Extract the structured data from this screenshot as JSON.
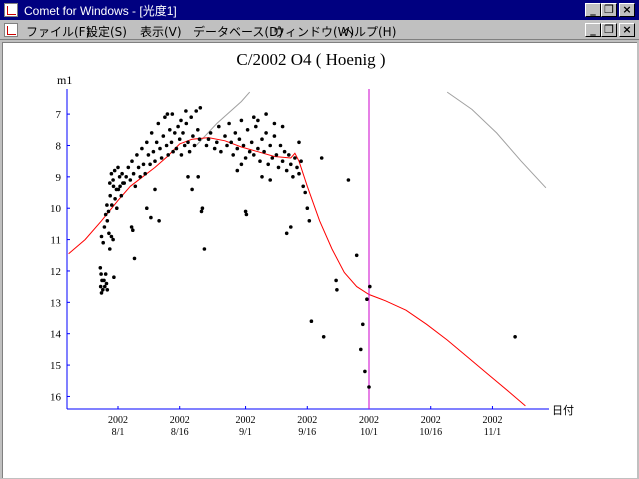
{
  "window": {
    "title": "Comet for Windows - [光度1]",
    "buttons": {
      "minimize": "_",
      "restore": "❐",
      "close": "×"
    }
  },
  "menu": {
    "items": [
      "ファイル(F)",
      "設定(S)",
      "表示(V)",
      "データベース(D)",
      "ウィンドウ(W)",
      "ヘルプ(H)"
    ]
  },
  "chart_data": {
    "type": "scatter",
    "title": "C/2002 O4 ( Hoenig )",
    "ylabel": "m1",
    "xlabel": "日付",
    "y_ticks": [
      7,
      8,
      9,
      10,
      11,
      12,
      13,
      14,
      15,
      16
    ],
    "ylim": [
      6.2,
      16.4
    ],
    "xlim_day": [
      -15.5,
      70.5
    ],
    "x_ticks": [
      {
        "day": 0,
        "label": "2002\n8/1"
      },
      {
        "day": 15,
        "label": "2002\n8/16"
      },
      {
        "day": 31,
        "label": "2002\n9/1"
      },
      {
        "day": 46,
        "label": "2002\n9/16"
      },
      {
        "day": 61,
        "label": "2002\n10/1"
      },
      {
        "day": 76,
        "label": "2002\n10/16"
      },
      {
        "day": 91,
        "label": "2002\n11/1"
      }
    ],
    "current_date_day": 61,
    "colors": {
      "observations": "#000000",
      "model_curve": "#ff0000",
      "current_date": "#cc00cc",
      "axes": "#0000ff",
      "secondary_curve": "#a0a0a0"
    },
    "model_curve": [
      [
        -12,
        11.45
      ],
      [
        -8,
        11.0
      ],
      [
        -4,
        10.4
      ],
      [
        0,
        9.75
      ],
      [
        3,
        9.3
      ],
      [
        6,
        9.0
      ],
      [
        9,
        8.7
      ],
      [
        12,
        8.35
      ],
      [
        15,
        7.95
      ],
      [
        18,
        7.8
      ],
      [
        22,
        7.75
      ],
      [
        26,
        7.85
      ],
      [
        30,
        8.05
      ],
      [
        34,
        8.2
      ],
      [
        38,
        8.35
      ],
      [
        42,
        8.4
      ],
      [
        43,
        8.25
      ],
      [
        44,
        8.5
      ],
      [
        46,
        9.3
      ],
      [
        49,
        10.4
      ],
      [
        52,
        11.3
      ],
      [
        55,
        12.05
      ],
      [
        58,
        12.5
      ],
      [
        61,
        12.75
      ],
      [
        65,
        12.95
      ],
      [
        70,
        13.25
      ],
      [
        75,
        13.7
      ],
      [
        80,
        14.2
      ],
      [
        85,
        14.75
      ],
      [
        90,
        15.3
      ],
      [
        95,
        15.85
      ],
      [
        99,
        16.3
      ]
    ],
    "secondary_curve": [
      [
        19,
        8.0
      ],
      [
        24,
        7.3
      ],
      [
        30,
        6.6
      ],
      [
        32,
        6.3
      ]
    ],
    "secondary_curve_2": [
      [
        80,
        6.3
      ],
      [
        86,
        6.85
      ],
      [
        92,
        7.6
      ],
      [
        98,
        8.5
      ],
      [
        104,
        9.35
      ]
    ],
    "observations": [
      [
        -4.3,
        11.9
      ],
      [
        -4.1,
        12.1
      ],
      [
        -3.9,
        12.3
      ],
      [
        -4.2,
        12.5
      ],
      [
        -4.0,
        12.7
      ],
      [
        -3.7,
        12.6
      ],
      [
        -3.4,
        12.3
      ],
      [
        -3.2,
        12.5
      ],
      [
        -3.0,
        12.1
      ],
      [
        -2.8,
        12.4
      ],
      [
        -2.6,
        12.6
      ],
      [
        -4.0,
        10.9
      ],
      [
        -3.6,
        11.1
      ],
      [
        -3.3,
        10.6
      ],
      [
        -3.0,
        10.2
      ],
      [
        -2.6,
        10.4
      ],
      [
        -2.2,
        10.8
      ],
      [
        -2.0,
        11.3
      ],
      [
        -1.6,
        10.9
      ],
      [
        -1.2,
        11.0
      ],
      [
        -1.0,
        12.2
      ],
      [
        -2.7,
        9.9
      ],
      [
        -2.3,
        10.1
      ],
      [
        -1.9,
        9.6
      ],
      [
        -1.5,
        9.9
      ],
      [
        -1.1,
        9.3
      ],
      [
        -0.7,
        9.7
      ],
      [
        -0.3,
        10.0
      ],
      [
        0.1,
        9.4
      ],
      [
        0.4,
        9.0
      ],
      [
        0.8,
        9.6
      ],
      [
        1.2,
        9.2
      ],
      [
        -2.0,
        9.2
      ],
      [
        -1.6,
        8.9
      ],
      [
        -1.2,
        9.1
      ],
      [
        -0.8,
        8.8
      ],
      [
        -0.4,
        9.4
      ],
      [
        0.0,
        8.7
      ],
      [
        0.5,
        9.3
      ],
      [
        1.0,
        8.9
      ],
      [
        1.5,
        9.2
      ],
      [
        2.0,
        9.0
      ],
      [
        2.5,
        8.7
      ],
      [
        3.0,
        9.1
      ],
      [
        3.4,
        8.5
      ],
      [
        3.8,
        8.9
      ],
      [
        4.2,
        9.3
      ],
      [
        4.6,
        8.3
      ],
      [
        5.0,
        8.7
      ],
      [
        5.4,
        9.0
      ],
      [
        5.8,
        8.1
      ],
      [
        6.2,
        8.6
      ],
      [
        6.6,
        8.9
      ],
      [
        7.0,
        7.9
      ],
      [
        3.3,
        10.6
      ],
      [
        3.6,
        10.7
      ],
      [
        4.0,
        11.6
      ],
      [
        7.0,
        10.0
      ],
      [
        8.0,
        10.3
      ],
      [
        9.0,
        9.4
      ],
      [
        10.0,
        10.4
      ],
      [
        7.4,
        8.3
      ],
      [
        7.8,
        8.6
      ],
      [
        8.2,
        7.6
      ],
      [
        8.6,
        8.2
      ],
      [
        9.0,
        8.5
      ],
      [
        9.4,
        7.9
      ],
      [
        9.8,
        7.3
      ],
      [
        10.2,
        8.1
      ],
      [
        10.6,
        8.4
      ],
      [
        11.0,
        7.7
      ],
      [
        11.4,
        7.1
      ],
      [
        11.8,
        8.0
      ],
      [
        12.2,
        8.3
      ],
      [
        12.6,
        7.5
      ],
      [
        13.0,
        7.9
      ],
      [
        13.4,
        8.2
      ],
      [
        13.8,
        7.6
      ],
      [
        14.2,
        8.1
      ],
      [
        14.6,
        7.4
      ],
      [
        15.0,
        7.8
      ],
      [
        15.4,
        8.3
      ],
      [
        15.8,
        7.6
      ],
      [
        16.2,
        8.0
      ],
      [
        16.6,
        7.3
      ],
      [
        17.0,
        7.9
      ],
      [
        17.4,
        8.2
      ],
      [
        17.8,
        7.1
      ],
      [
        18.2,
        7.7
      ],
      [
        18.6,
        8.0
      ],
      [
        19.0,
        6.9
      ],
      [
        19.4,
        7.5
      ],
      [
        19.8,
        7.8
      ],
      [
        12.0,
        7.0
      ],
      [
        13.2,
        7.0
      ],
      [
        15.3,
        7.2
      ],
      [
        16.5,
        6.9
      ],
      [
        20.0,
        6.8
      ],
      [
        17.0,
        9.0
      ],
      [
        18.0,
        9.4
      ],
      [
        19.5,
        9.0
      ],
      [
        20.5,
        10.0
      ],
      [
        20.3,
        10.1
      ],
      [
        21.0,
        11.3
      ],
      [
        21.5,
        8.0
      ],
      [
        22.0,
        7.8
      ],
      [
        22.5,
        7.6
      ],
      [
        23.5,
        8.1
      ],
      [
        24.0,
        7.9
      ],
      [
        24.5,
        7.4
      ],
      [
        25.0,
        8.2
      ],
      [
        26.0,
        7.7
      ],
      [
        26.5,
        8.0
      ],
      [
        27.0,
        7.3
      ],
      [
        27.5,
        7.9
      ],
      [
        28.0,
        8.3
      ],
      [
        28.5,
        7.6
      ],
      [
        29.0,
        8.1
      ],
      [
        29.5,
        7.8
      ],
      [
        30.0,
        7.2
      ],
      [
        30.5,
        8.0
      ],
      [
        31.0,
        8.4
      ],
      [
        31.5,
        7.5
      ],
      [
        32.0,
        8.2
      ],
      [
        32.5,
        7.9
      ],
      [
        33.0,
        8.3
      ],
      [
        33.5,
        7.4
      ],
      [
        34.0,
        8.1
      ],
      [
        34.5,
        8.5
      ],
      [
        35.0,
        7.8
      ],
      [
        35.5,
        8.2
      ],
      [
        36.0,
        7.6
      ],
      [
        36.5,
        8.6
      ],
      [
        37.0,
        8.0
      ],
      [
        37.5,
        8.4
      ],
      [
        38.0,
        7.7
      ],
      [
        38.5,
        8.3
      ],
      [
        39.0,
        8.7
      ],
      [
        39.5,
        8.0
      ],
      [
        40.0,
        8.5
      ],
      [
        40.5,
        8.2
      ],
      [
        41.0,
        8.8
      ],
      [
        41.5,
        8.3
      ],
      [
        42.0,
        8.6
      ],
      [
        42.5,
        9.0
      ],
      [
        43.0,
        8.4
      ],
      [
        43.5,
        8.7
      ],
      [
        44.0,
        8.9
      ],
      [
        44.5,
        8.5
      ],
      [
        45.0,
        9.3
      ],
      [
        45.5,
        9.5
      ],
      [
        46.0,
        10.0
      ],
      [
        46.5,
        10.4
      ],
      [
        29.0,
        8.8
      ],
      [
        30.0,
        8.6
      ],
      [
        31.0,
        10.1
      ],
      [
        31.2,
        10.2
      ],
      [
        35.0,
        9.0
      ],
      [
        37.0,
        9.1
      ],
      [
        41.0,
        10.8
      ],
      [
        42.0,
        10.6
      ],
      [
        44.0,
        7.9
      ],
      [
        33.0,
        7.1
      ],
      [
        34.0,
        7.2
      ],
      [
        36.0,
        7.0
      ],
      [
        38.0,
        7.3
      ],
      [
        40.0,
        7.4
      ],
      [
        47.0,
        13.6
      ],
      [
        49.5,
        8.4
      ],
      [
        50.0,
        14.1
      ],
      [
        53.0,
        12.3
      ],
      [
        53.2,
        12.6
      ],
      [
        56.0,
        9.1
      ],
      [
        58.0,
        11.5
      ],
      [
        59.0,
        14.5
      ],
      [
        59.5,
        13.7
      ],
      [
        60.0,
        15.2
      ],
      [
        60.5,
        12.9
      ],
      [
        61.0,
        15.7
      ],
      [
        61.2,
        12.5
      ],
      [
        96.5,
        14.1
      ]
    ]
  }
}
